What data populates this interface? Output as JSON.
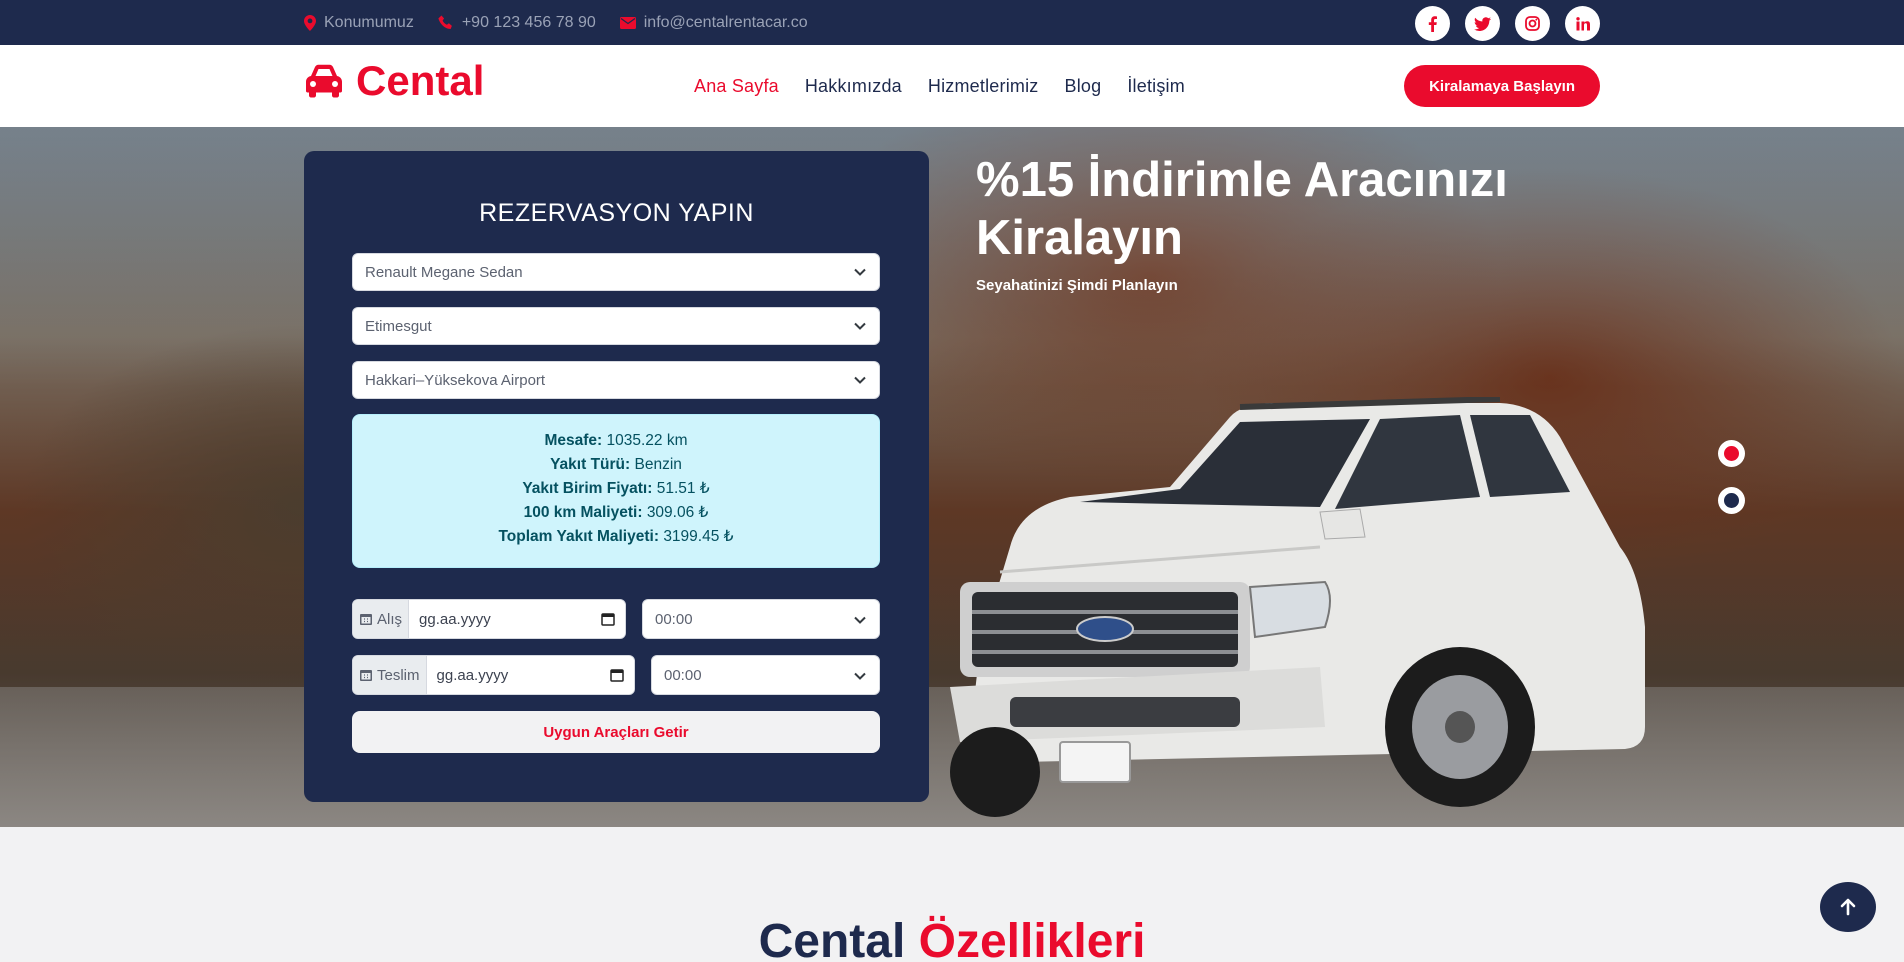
{
  "topbar": {
    "location": "Konumumuz",
    "phone": "+90 123 456 78 90",
    "email": "info@centalrentacar.co",
    "socials": [
      "facebook-icon",
      "twitter-icon",
      "instagram-icon",
      "linkedin-icon"
    ]
  },
  "navbar": {
    "brand": "Cental",
    "links": [
      "Ana Sayfa",
      "Hakkımızda",
      "Hizmetlerimiz",
      "Blog",
      "İletişim"
    ],
    "active_link": "Ana Sayfa",
    "cta": "Kiralamaya Başlayın"
  },
  "booking": {
    "title": "REZERVASYON YAPIN",
    "car_select": "Renault Megane Sedan",
    "pickup_location": "Etimesgut",
    "dropoff_location": "Hakkari–Yüksekova Airport",
    "info": {
      "distance_label": "Mesafe:",
      "distance_value": "1035.22 km",
      "fuel_type_label": "Yakıt Türü:",
      "fuel_type_value": "Benzin",
      "fuel_price_label": "Yakıt Birim Fiyatı:",
      "fuel_price_value": "51.51 ₺",
      "cost_100km_label": "100 km Maliyeti:",
      "cost_100km_value": "309.06 ₺",
      "total_cost_label": "Toplam Yakıt Maliyeti:",
      "total_cost_value": "3199.45 ₺"
    },
    "pickup_label": "Alış",
    "pickup_date_placeholder": "gg.aa.yyyy",
    "pickup_time": "00:00",
    "return_label": "Teslim",
    "return_date_placeholder": "gg.aa.yyyy",
    "return_time": "00:00",
    "submit": "Uygun Araçları Getir"
  },
  "hero": {
    "title": "%15 İndirimle Aracınızı Kiralayın",
    "subtitle": "Seyahatinizi Şimdi Planlayın",
    "slides": 2,
    "active_slide": 1
  },
  "features": {
    "title_main": "Cental",
    "title_accent": "Özellikleri"
  },
  "colors": {
    "primary": "#ea0b2d",
    "secondary": "#1e2a4d",
    "info_bg": "#cff4fc"
  }
}
